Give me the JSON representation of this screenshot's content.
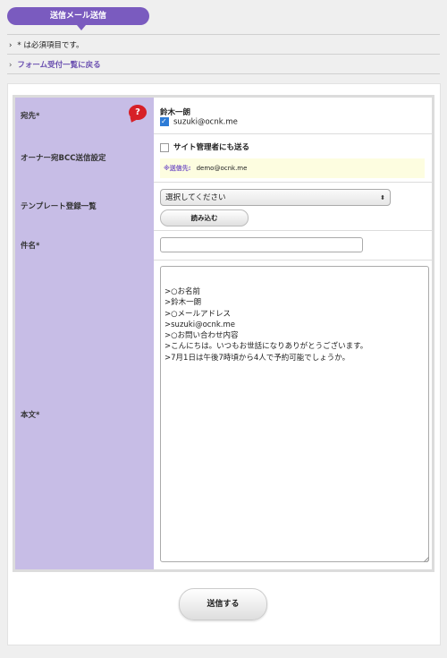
{
  "header": {
    "title": "送信メール送信"
  },
  "notes": {
    "required_note": "* は必須項目です。",
    "back_link": "フォーム受付一覧に戻る"
  },
  "form": {
    "to": {
      "label": "宛先*",
      "help": "?",
      "name": "鈴木一朗",
      "email": "suzuki@ocnk.me",
      "checked": true
    },
    "bcc": {
      "label": "オーナー宛BCC送信設定",
      "checkbox_label": "サイト管理者にも送る",
      "dest_label": "※送信先:",
      "dest_email": "demo@ocnk.me"
    },
    "template": {
      "label": "テンプレート登録一覧",
      "selected": "選択してください",
      "load_button": "読み込む"
    },
    "subject": {
      "label": "件名*",
      "value": ""
    },
    "body": {
      "label": "本文*",
      "value": ">○お名前\n>鈴木一朗\n>○メールアドレス\n>suzuki@ocnk.me\n>○お問い合わせ内容\n>こんにちは。いつもお世話になりありがとうございます。\n>7月1日は午後7時頃から4人で予約可能でしょうか。"
    }
  },
  "actions": {
    "submit": "送信する"
  },
  "colors": {
    "accent": "#7a5bbf",
    "label_bg": "#c7bde6",
    "help": "#d72027"
  }
}
